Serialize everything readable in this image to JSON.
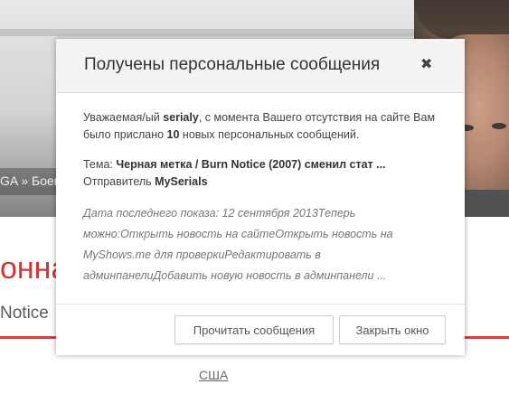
{
  "background": {
    "breadcrumb": "GA » Боевик",
    "red_title": "онная",
    "subtitle": "Notice",
    "country_link": "США"
  },
  "modal": {
    "title": "Получены персональные сообщения",
    "close_glyph": "✖",
    "intro": {
      "part1": "Уважаемая/ый ",
      "username": "serialy",
      "part2": ", с момента Вашего отсутствия на сайте Вам было прислано ",
      "count": "10",
      "part3": " новых персональных сообщений."
    },
    "message": {
      "subject_label": "Тема: ",
      "subject": "Черная метка / Burn Notice (2007) сменил стат ...",
      "sender_label": "Отправитель ",
      "sender": "MySerials"
    },
    "preview": "Дата последнего показа: 12 сентября 2013Теперь можно:Открыть новость на сайтеОткрыть новость на MyShows.me для проверкиРедактировать в админпанелиДобавить новую новость в админпанели ...",
    "buttons": {
      "read": "Прочитать сообщения",
      "close": "Закрыть окно"
    }
  },
  "colors": {
    "accent_red": "#c62828",
    "header_bg": "#f3f3f3"
  }
}
